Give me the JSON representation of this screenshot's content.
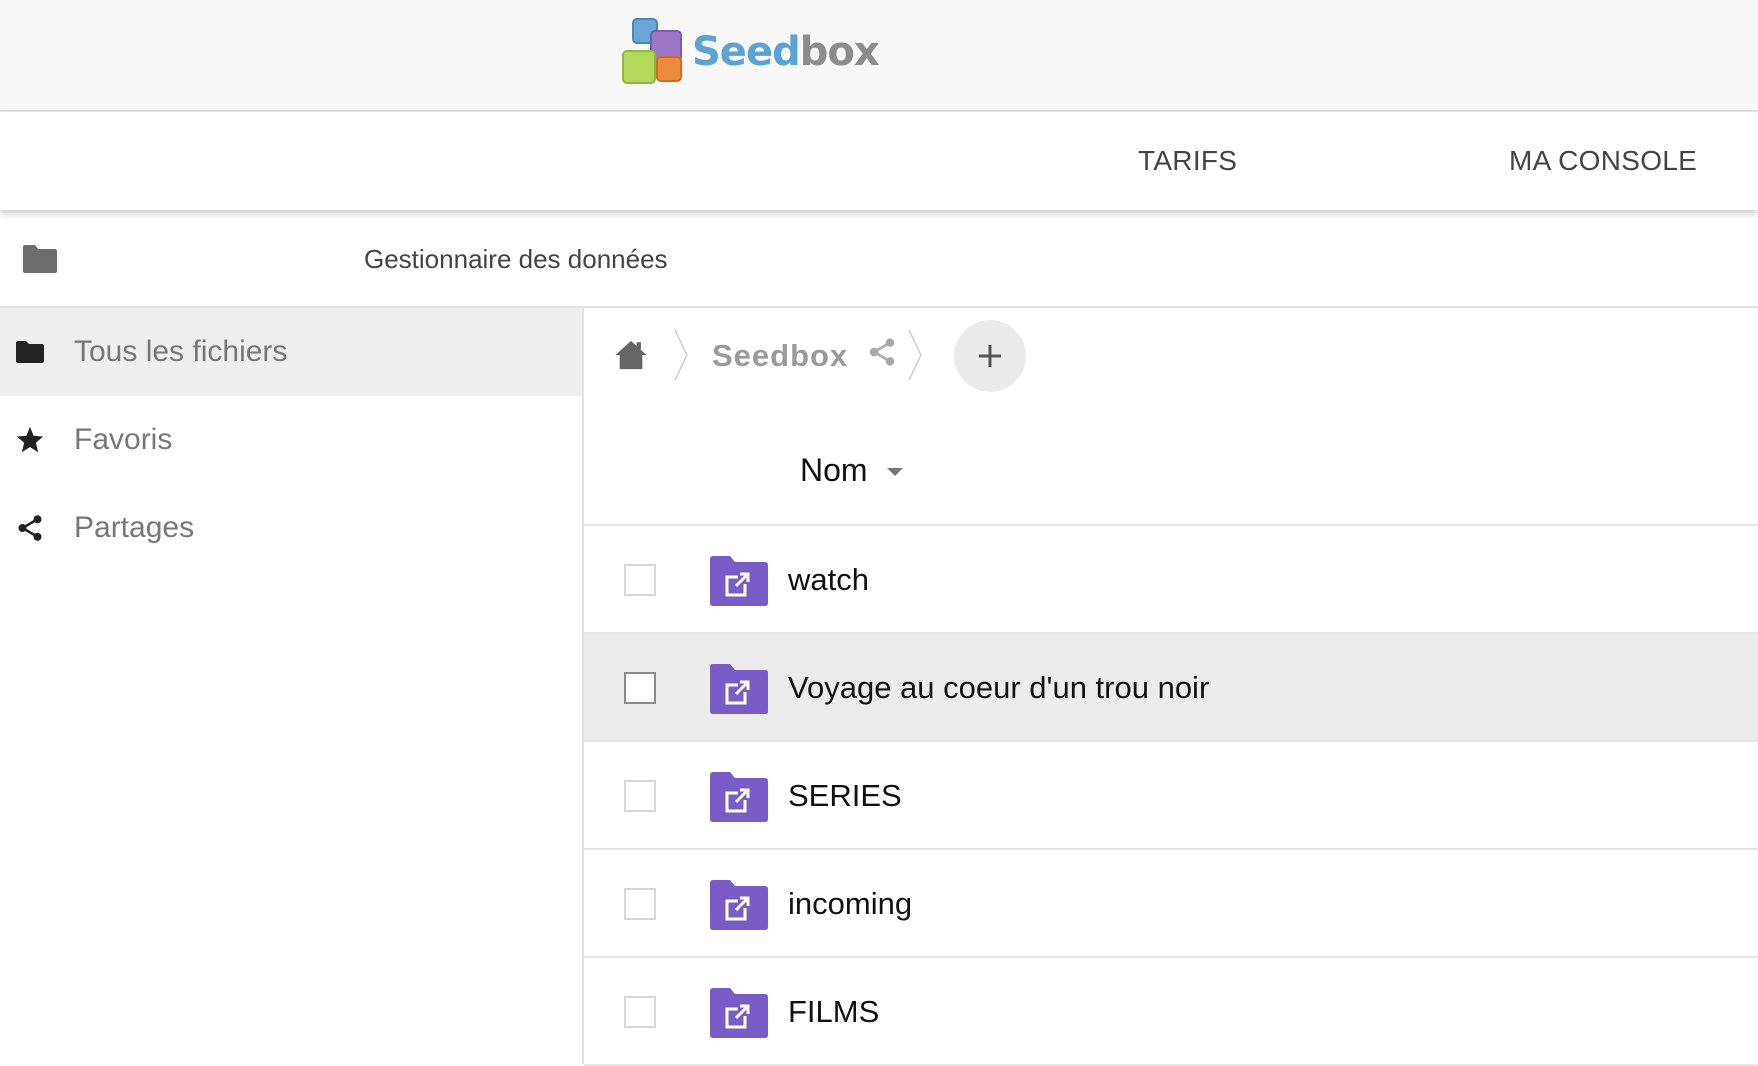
{
  "brand": {
    "logo_text_color": "Seed",
    "logo_text_gray": "box"
  },
  "nav": {
    "tarifs": "TARIFS",
    "console": "MA CONSOLE"
  },
  "section": {
    "title": "Gestionnaire des données"
  },
  "sidebar": {
    "items": [
      {
        "label": "Tous les fichiers",
        "icon": "folder-icon",
        "active": true
      },
      {
        "label": "Favoris",
        "icon": "star-icon",
        "active": false
      },
      {
        "label": "Partages",
        "icon": "share-icon",
        "active": false
      }
    ]
  },
  "breadcrumb": {
    "current": "Seedbox"
  },
  "table": {
    "column_name": "Nom",
    "rows": [
      {
        "name": "watch",
        "icon": "shared-folder-icon"
      },
      {
        "name": "Voyage au coeur d'un trou noir",
        "icon": "shared-folder-icon",
        "highlighted": true
      },
      {
        "name": "SERIES",
        "icon": "shared-folder-icon"
      },
      {
        "name": "incoming",
        "icon": "shared-folder-icon"
      },
      {
        "name": "FILMS",
        "icon": "shared-folder-icon"
      }
    ]
  },
  "colors": {
    "folder_accent": "#7a5cc6",
    "row_highlight": "#ececec",
    "logo_blue": "#5aa3d4"
  }
}
